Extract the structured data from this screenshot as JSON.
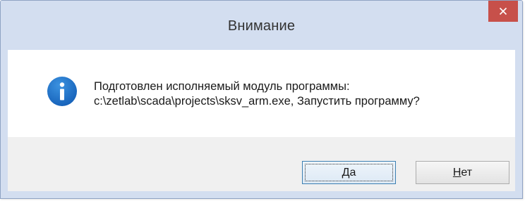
{
  "dialog": {
    "title": "Внимание",
    "icon": "info-icon",
    "message_line1": "Подготовлен исполняемый модуль программы:",
    "message_line2": "c:\\zetlab\\scada\\projects\\sksv_arm.exe, Запустить программу?",
    "buttons": {
      "yes": {
        "mnemonic": "Д",
        "rest": "а"
      },
      "no": {
        "mnemonic": "Н",
        "rest": "ет"
      }
    },
    "close_icon": "close-icon"
  },
  "colors": {
    "frame": "#d3def0",
    "close": "#c7504a",
    "info_icon": "#1e73c8",
    "footer": "#f0f0f0"
  }
}
